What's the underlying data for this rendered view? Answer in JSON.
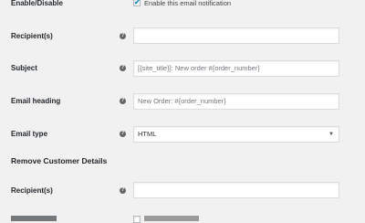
{
  "enable": {
    "label": "Enable/Disable",
    "checkbox_label": "Enable this email notification",
    "checked": true
  },
  "recipients": {
    "label": "Recipient(s)",
    "value": ""
  },
  "subject": {
    "label": "Subject",
    "placeholder": "[{site_title}]: New order #{order_number}"
  },
  "email_heading": {
    "label": "Email heading",
    "placeholder": "New Order: #{order_number}"
  },
  "email_type": {
    "label": "Email type",
    "selected": "HTML"
  },
  "remove_section": {
    "title": "Remove Customer Details",
    "recipients_label": "Recipient(s)",
    "recipients_value": ""
  },
  "help_icon": "question-mark"
}
